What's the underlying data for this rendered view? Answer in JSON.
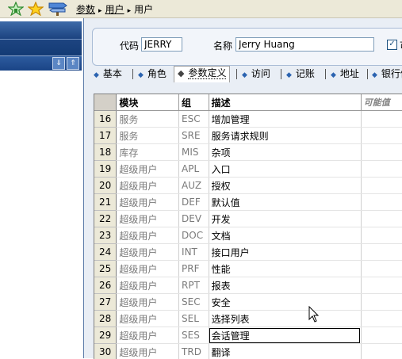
{
  "toolbar": {
    "icons": [
      "home-star-icon",
      "favorites-star-icon",
      "signpost-icon"
    ],
    "breadcrumb": [
      "参数",
      "用户",
      "用户"
    ]
  },
  "form": {
    "code_label": "代码",
    "code_value": "JERRY",
    "name_label": "名称",
    "name_value": "Jerry Huang",
    "checkbox_label": "可"
  },
  "tabs": [
    "基本",
    "角色",
    "参数定义",
    "访问",
    "记账",
    "地址",
    "银行信"
  ],
  "active_tab": 2,
  "grid": {
    "columns": [
      "模块",
      "组",
      "描述",
      "可能值"
    ],
    "rows": [
      {
        "n": "16",
        "module": "服务",
        "group": "ESC",
        "desc": "增加管理"
      },
      {
        "n": "17",
        "module": "服务",
        "group": "SRE",
        "desc": "服务请求规则"
      },
      {
        "n": "18",
        "module": "库存",
        "group": "MIS",
        "desc": "杂项"
      },
      {
        "n": "19",
        "module": "超级用户",
        "group": "APL",
        "desc": "入口"
      },
      {
        "n": "20",
        "module": "超级用户",
        "group": "AUZ",
        "desc": "授权"
      },
      {
        "n": "21",
        "module": "超级用户",
        "group": "DEF",
        "desc": "默认值"
      },
      {
        "n": "22",
        "module": "超级用户",
        "group": "DEV",
        "desc": "开发"
      },
      {
        "n": "23",
        "module": "超级用户",
        "group": "DOC",
        "desc": "文档"
      },
      {
        "n": "24",
        "module": "超级用户",
        "group": "INT",
        "desc": "接口用户"
      },
      {
        "n": "25",
        "module": "超级用户",
        "group": "PRF",
        "desc": "性能"
      },
      {
        "n": "26",
        "module": "超级用户",
        "group": "RPT",
        "desc": "报表"
      },
      {
        "n": "27",
        "module": "超级用户",
        "group": "SEC",
        "desc": "安全"
      },
      {
        "n": "28",
        "module": "超级用户",
        "group": "SEL",
        "desc": "选择列表"
      },
      {
        "n": "29",
        "module": "超级用户",
        "group": "SES",
        "desc": "会话管理"
      },
      {
        "n": "30",
        "module": "超级用户",
        "group": "TRD",
        "desc": "翻译"
      }
    ],
    "selected_row": 13
  }
}
